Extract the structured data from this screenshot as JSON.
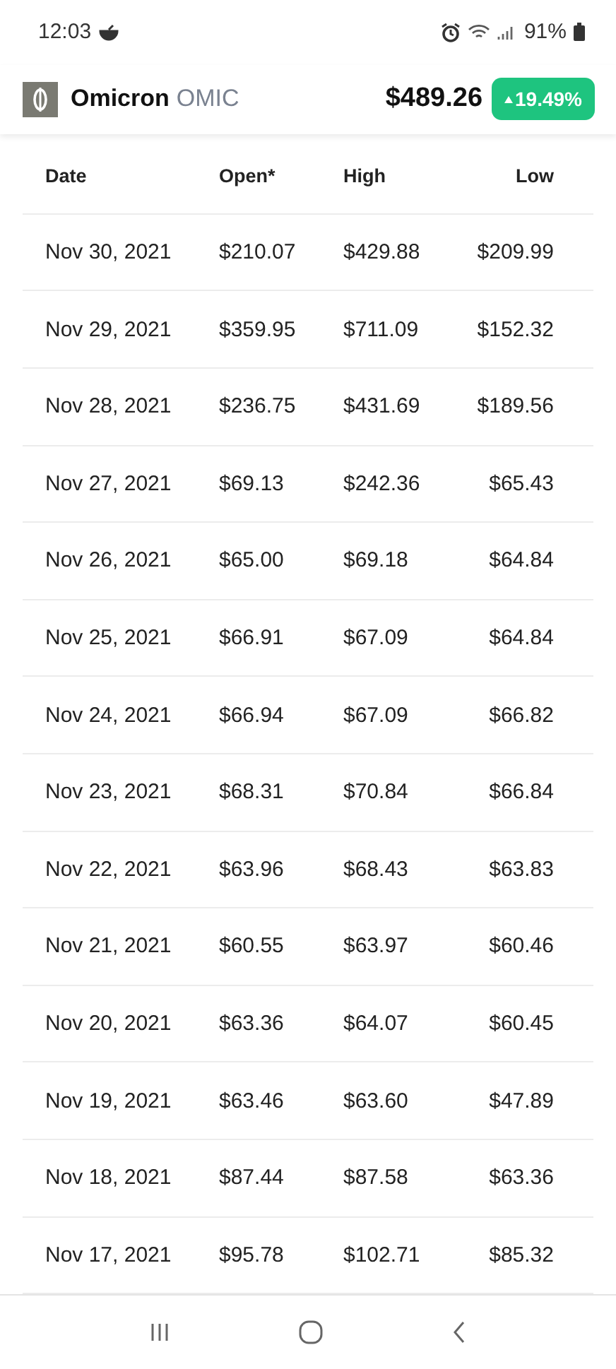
{
  "status_bar": {
    "time": "12:03",
    "battery": "91%"
  },
  "header": {
    "name": "Omicron",
    "symbol": "OMIC",
    "price": "$489.26",
    "change": "19.49%",
    "rising": true
  },
  "table": {
    "columns": [
      "Date",
      "Open*",
      "High",
      "Low"
    ],
    "rows": [
      [
        "Nov 30, 2021",
        "$210.07",
        "$429.88",
        "$209.99"
      ],
      [
        "Nov 29, 2021",
        "$359.95",
        "$711.09",
        "$152.32"
      ],
      [
        "Nov 28, 2021",
        "$236.75",
        "$431.69",
        "$189.56"
      ],
      [
        "Nov 27, 2021",
        "$69.13",
        "$242.36",
        "$65.43"
      ],
      [
        "Nov 26, 2021",
        "$65.00",
        "$69.18",
        "$64.84"
      ],
      [
        "Nov 25, 2021",
        "$66.91",
        "$67.09",
        "$64.84"
      ],
      [
        "Nov 24, 2021",
        "$66.94",
        "$67.09",
        "$66.82"
      ],
      [
        "Nov 23, 2021",
        "$68.31",
        "$70.84",
        "$66.84"
      ],
      [
        "Nov 22, 2021",
        "$63.96",
        "$68.43",
        "$63.83"
      ],
      [
        "Nov 21, 2021",
        "$60.55",
        "$63.97",
        "$60.46"
      ],
      [
        "Nov 20, 2021",
        "$63.36",
        "$64.07",
        "$60.45"
      ],
      [
        "Nov 19, 2021",
        "$63.46",
        "$63.60",
        "$47.89"
      ],
      [
        "Nov 18, 2021",
        "$87.44",
        "$87.58",
        "$63.36"
      ],
      [
        "Nov 17, 2021",
        "$95.78",
        "$102.71",
        "$85.32"
      ]
    ]
  }
}
